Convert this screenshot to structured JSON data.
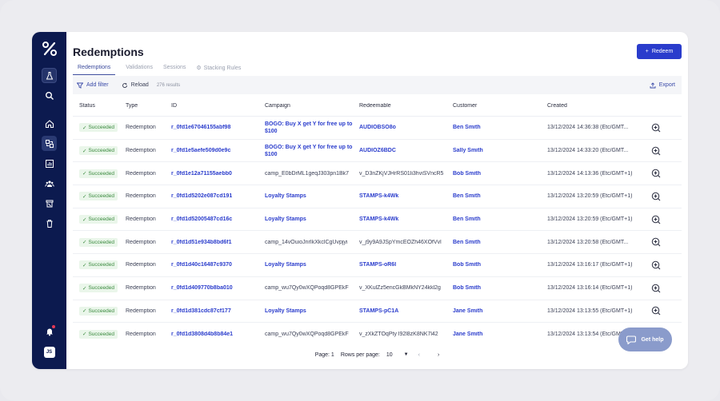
{
  "sidebar": {
    "logo": "%",
    "avatar_initials": "JS"
  },
  "header": {
    "title": "Redemptions",
    "redeem_button": "Redeem"
  },
  "tabs": [
    {
      "label": "Redemptions",
      "active": true
    },
    {
      "label": "Validations",
      "active": false
    },
    {
      "label": "Sessions",
      "active": false
    },
    {
      "label": "Stacking Rules",
      "active": false
    }
  ],
  "toolbar": {
    "add_filter": "Add filter",
    "reload": "Reload",
    "results": "276 results",
    "export": "Export"
  },
  "table": {
    "columns": [
      "Status",
      "Type",
      "ID",
      "Campaign",
      "Redeemable",
      "Customer",
      "Created"
    ],
    "rows": [
      {
        "status": "Succeeded",
        "type": "Redemption",
        "id": "r_0fd1e67046155abf98",
        "campaign": "BOGO: Buy X get Y for free up to $100",
        "campaign_link": true,
        "redeemable": "AUDIOBSO8o",
        "redeemable_link": true,
        "customer": "Ben Smith",
        "created": "13/12/2024 14:36:38 (Etc/GMT..."
      },
      {
        "status": "Succeeded",
        "type": "Redemption",
        "id": "r_0fd1e5aefe509d0e9c",
        "campaign": "BOGO: Buy X get Y for free up to $100",
        "campaign_link": true,
        "redeemable": "AUDIOZ6BDC",
        "redeemable_link": true,
        "customer": "Sally Smith",
        "created": "13/12/2024 14:33:20 (Etc/GMT..."
      },
      {
        "status": "Succeeded",
        "type": "Redemption",
        "id": "r_0fd1e12a71155aebb0",
        "campaign": "camp_E0bDrML1geqJ303pn1Bk7",
        "campaign_link": false,
        "redeemable": "v_D3nZKjVJHrRS01li3hviSVncR5",
        "redeemable_link": false,
        "customer": "Bob Smith",
        "created": "13/12/2024 14:13:36 (Etc/GMT+1)"
      },
      {
        "status": "Succeeded",
        "type": "Redemption",
        "id": "r_0fd1d5202e087cd191",
        "campaign": "Loyalty Stamps",
        "campaign_link": true,
        "redeemable": "STAMPS-k4Wk",
        "redeemable_link": true,
        "customer": "Ben Smith",
        "created": "13/12/2024 13:20:59 (Etc/GMT+1)"
      },
      {
        "status": "Succeeded",
        "type": "Redemption",
        "id": "r_0fd1d52005487cd16c",
        "campaign": "Loyalty Stamps",
        "campaign_link": true,
        "redeemable": "STAMPS-k4Wk",
        "redeemable_link": true,
        "customer": "Ben Smith",
        "created": "13/12/2024 13:20:59 (Etc/GMT+1)"
      },
      {
        "status": "Succeeded",
        "type": "Redemption",
        "id": "r_0fd1d51e934b8bd6f1",
        "campaign": "camp_14vOuioJnrIkXkclCgUvpjyi",
        "campaign_link": false,
        "redeemable": "v_j9y9A9JSpYmcEOZh46XOfVvl",
        "redeemable_link": false,
        "customer": "Ben Smith",
        "created": "13/12/2024 13:20:58 (Etc/GMT..."
      },
      {
        "status": "Succeeded",
        "type": "Redemption",
        "id": "r_0fd1d40c16487c9370",
        "campaign": "Loyalty Stamps",
        "campaign_link": true,
        "redeemable": "STAMPS-oR6I",
        "redeemable_link": true,
        "customer": "Bob Smith",
        "created": "13/12/2024 13:16:17 (Etc/GMT+1)"
      },
      {
        "status": "Succeeded",
        "type": "Redemption",
        "id": "r_0fd1d409770b8ba010",
        "campaign": "camp_wu7Qy0wXQPoqd8GPEkF",
        "campaign_link": false,
        "redeemable": "v_XKulZz5encGkBMkNY24kkl2g",
        "redeemable_link": false,
        "customer": "Bob Smith",
        "created": "13/12/2024 13:16:14 (Etc/GMT+1)"
      },
      {
        "status": "Succeeded",
        "type": "Redemption",
        "id": "r_0fd1d381cdc87cf177",
        "campaign": "Loyalty Stamps",
        "campaign_link": true,
        "redeemable": "STAMPS-pC1A",
        "redeemable_link": true,
        "customer": "Jane Smith",
        "created": "13/12/2024 13:13:55 (Etc/GMT+1)"
      },
      {
        "status": "Succeeded",
        "type": "Redemption",
        "id": "r_0fd1d3808d4b8b84e1",
        "campaign": "camp_wu7Qy0wXQPoqd8GPEkF",
        "campaign_link": false,
        "redeemable": "v_zXkZTOqPty l92l8zK8NK7l42",
        "redeemable_link": false,
        "customer": "Jane Smith",
        "created": "13/12/2024 13:13:54 (Etc/GMT+1)"
      }
    ]
  },
  "pager": {
    "page_label": "Page: 1",
    "rows_label": "Rows per page:",
    "rows_value": "10"
  },
  "help": {
    "label": "Get help"
  },
  "colors": {
    "sidebar": "#0c1a4f",
    "accent": "#2a3ccc",
    "success_bg": "#eaf6ea",
    "success_text": "#3a8a3e"
  }
}
